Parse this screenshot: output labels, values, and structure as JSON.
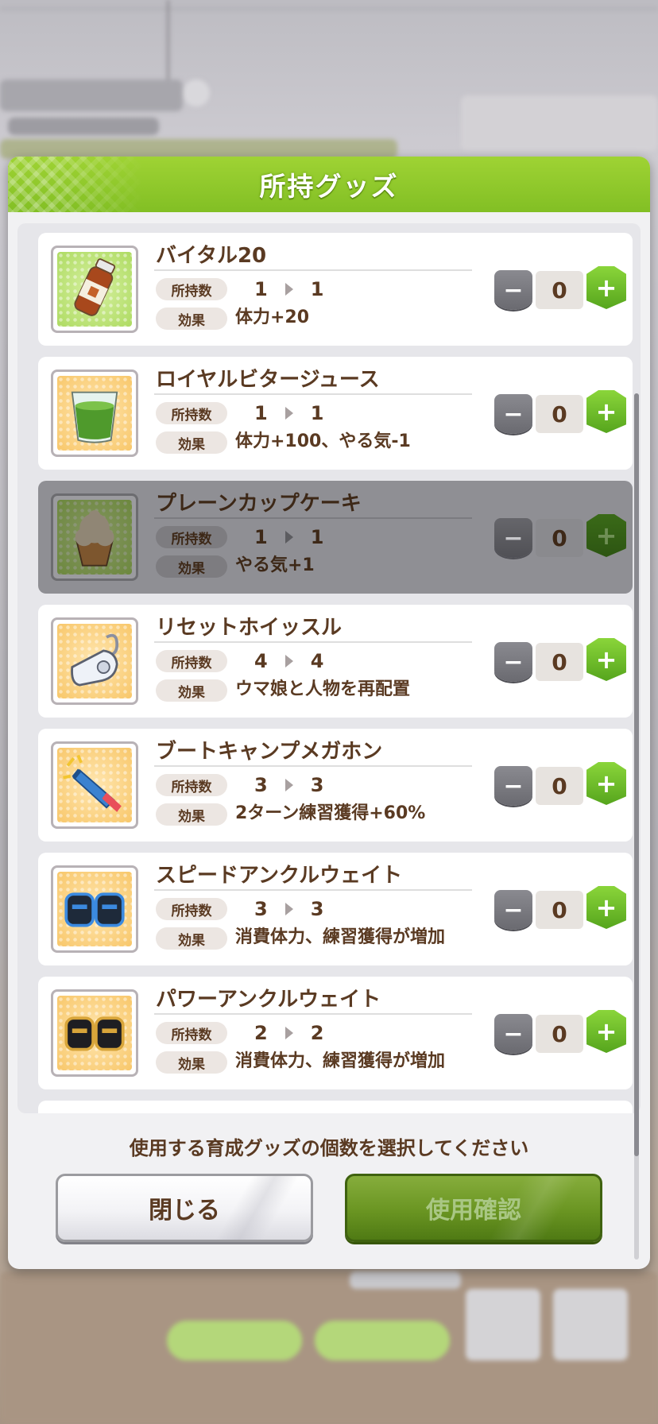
{
  "modal": {
    "title": "所持グッズ",
    "instruction": "使用する育成グッズの個数を選択してください",
    "close_label": "閉じる",
    "confirm_label": "使用確認"
  },
  "labels": {
    "owned": "所持数",
    "effect": "効果"
  },
  "items": [
    {
      "name": "バイタル20",
      "owned_before": "1",
      "owned_after": "1",
      "effect": "体力+20",
      "quantity": "0",
      "icon": "drink-bottle-icon",
      "frame": "green",
      "disabled": false
    },
    {
      "name": "ロイヤルビタージュース",
      "owned_before": "1",
      "owned_after": "1",
      "effect": "体力+100、やる気-1",
      "quantity": "0",
      "icon": "juice-glass-icon",
      "frame": "orange",
      "disabled": false
    },
    {
      "name": "プレーンカップケーキ",
      "owned_before": "1",
      "owned_after": "1",
      "effect": "やる気+1",
      "quantity": "0",
      "icon": "cupcake-icon",
      "frame": "green",
      "disabled": true
    },
    {
      "name": "リセットホイッスル",
      "owned_before": "4",
      "owned_after": "4",
      "effect": "ウマ娘と人物を再配置",
      "quantity": "0",
      "icon": "whistle-icon",
      "frame": "orange",
      "disabled": false
    },
    {
      "name": "ブートキャンプメガホン",
      "owned_before": "3",
      "owned_after": "3",
      "effect": "2ターン練習獲得+60%",
      "quantity": "0",
      "icon": "megaphone-icon",
      "frame": "orange",
      "disabled": false
    },
    {
      "name": "スピードアンクルウェイト",
      "owned_before": "3",
      "owned_after": "3",
      "effect": "消費体力、練習獲得が増加",
      "quantity": "0",
      "icon": "ankle-weight-blue-icon",
      "frame": "orange",
      "disabled": false
    },
    {
      "name": "パワーアンクルウェイト",
      "owned_before": "2",
      "owned_after": "2",
      "effect": "消費体力、練習獲得が増加",
      "quantity": "0",
      "icon": "ankle-weight-gold-icon",
      "frame": "orange",
      "disabled": false
    }
  ],
  "colors": {
    "header_green": "#8cc82a",
    "text_brown": "#5a3a22",
    "plus_green": "#56a51d",
    "minus_gray": "#76767c",
    "confirm_green": "#6a9522"
  }
}
